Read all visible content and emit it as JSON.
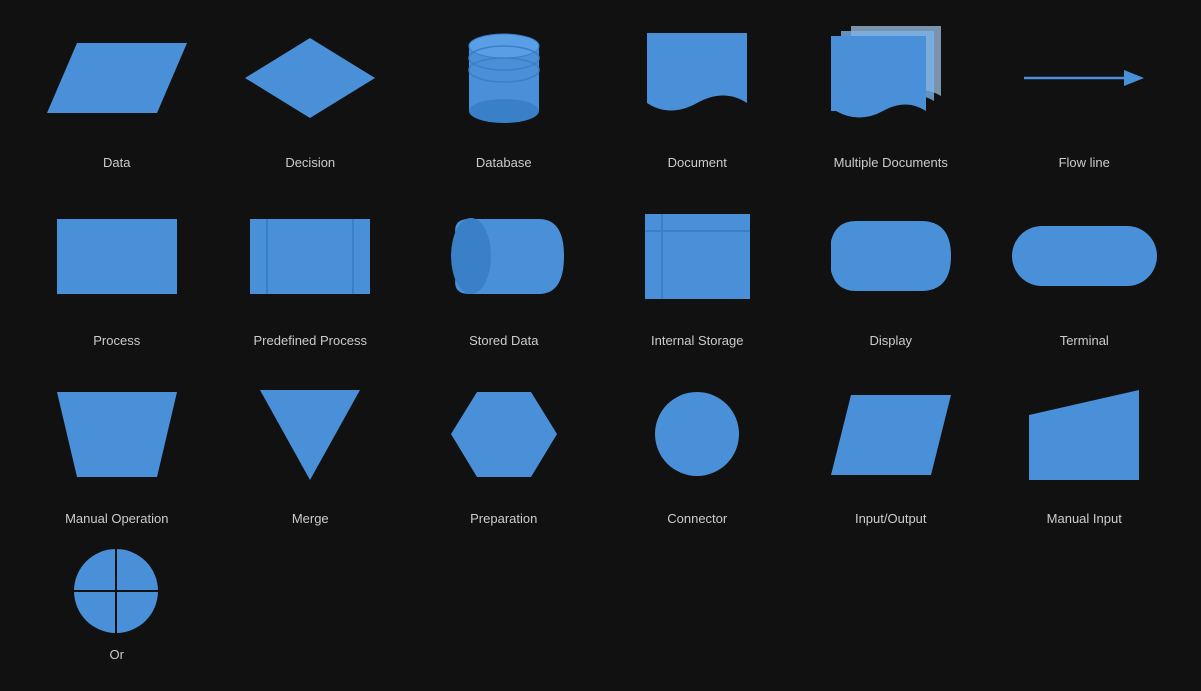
{
  "shapes": [
    {
      "id": "data",
      "label": "Data"
    },
    {
      "id": "decision",
      "label": "Decision"
    },
    {
      "id": "database",
      "label": "Database"
    },
    {
      "id": "document",
      "label": "Document"
    },
    {
      "id": "multiple-documents",
      "label": "Multiple Documents"
    },
    {
      "id": "flow-line",
      "label": "Flow line"
    },
    {
      "id": "process",
      "label": "Process"
    },
    {
      "id": "predefined-process",
      "label": "Predefined Process"
    },
    {
      "id": "stored-data",
      "label": "Stored Data"
    },
    {
      "id": "internal-storage",
      "label": "Internal Storage"
    },
    {
      "id": "display",
      "label": "Display"
    },
    {
      "id": "terminal",
      "label": "Terminal"
    },
    {
      "id": "manual-operation",
      "label": "Manual Operation"
    },
    {
      "id": "merge",
      "label": "Merge"
    },
    {
      "id": "preparation",
      "label": "Preparation"
    },
    {
      "id": "connector",
      "label": "Connector"
    },
    {
      "id": "input-output",
      "label": "Input/Output"
    },
    {
      "id": "manual-input",
      "label": "Manual Input"
    },
    {
      "id": "or",
      "label": "Or"
    }
  ],
  "colors": {
    "blue": "#4a90d9",
    "blue_light": "#7ab3e8",
    "blue_lighter": "#a8ccf0",
    "bg": "#111111"
  }
}
